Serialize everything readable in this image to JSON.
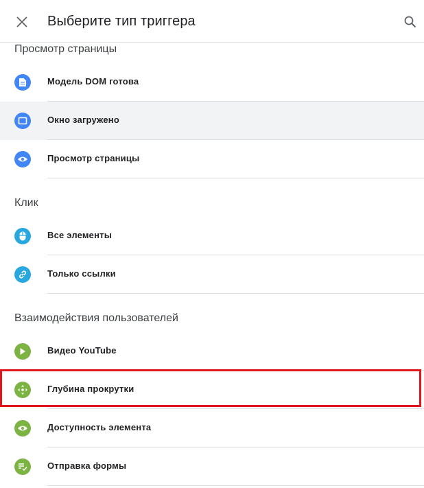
{
  "header": {
    "title": "Выберите тип триггера",
    "close_icon": "close-icon",
    "search_icon": "search-icon"
  },
  "sections": [
    {
      "label": "Просмотр страницы",
      "items": [
        {
          "label": "Модель DOM готова",
          "icon": "document-icon",
          "color": "#4285f4"
        },
        {
          "label": "Окно загружено",
          "icon": "window-icon",
          "color": "#4285f4",
          "selected": true
        },
        {
          "label": "Просмотр страницы",
          "icon": "eye-icon",
          "color": "#4285f4"
        }
      ]
    },
    {
      "label": "Клик",
      "items": [
        {
          "label": "Все элементы",
          "icon": "mouse-icon",
          "color": "#29a8e0"
        },
        {
          "label": "Только ссылки",
          "icon": "link-icon",
          "color": "#29a8e0"
        }
      ]
    },
    {
      "label": "Взаимодействия пользователей",
      "items": [
        {
          "label": "Видео YouTube",
          "icon": "play-icon",
          "color": "#7cb342"
        },
        {
          "label": "Глубина прокрутки",
          "icon": "scroll-arrows-icon",
          "color": "#7cb342",
          "highlighted": true
        },
        {
          "label": "Доступность элемента",
          "icon": "eye-icon",
          "color": "#7cb342"
        },
        {
          "label": "Отправка формы",
          "icon": "form-list-icon",
          "color": "#7cb342"
        }
      ]
    }
  ],
  "colors": {
    "highlight_border": "#e0161d",
    "selected_bg": "#f1f3f4",
    "divider": "#dadce0"
  }
}
